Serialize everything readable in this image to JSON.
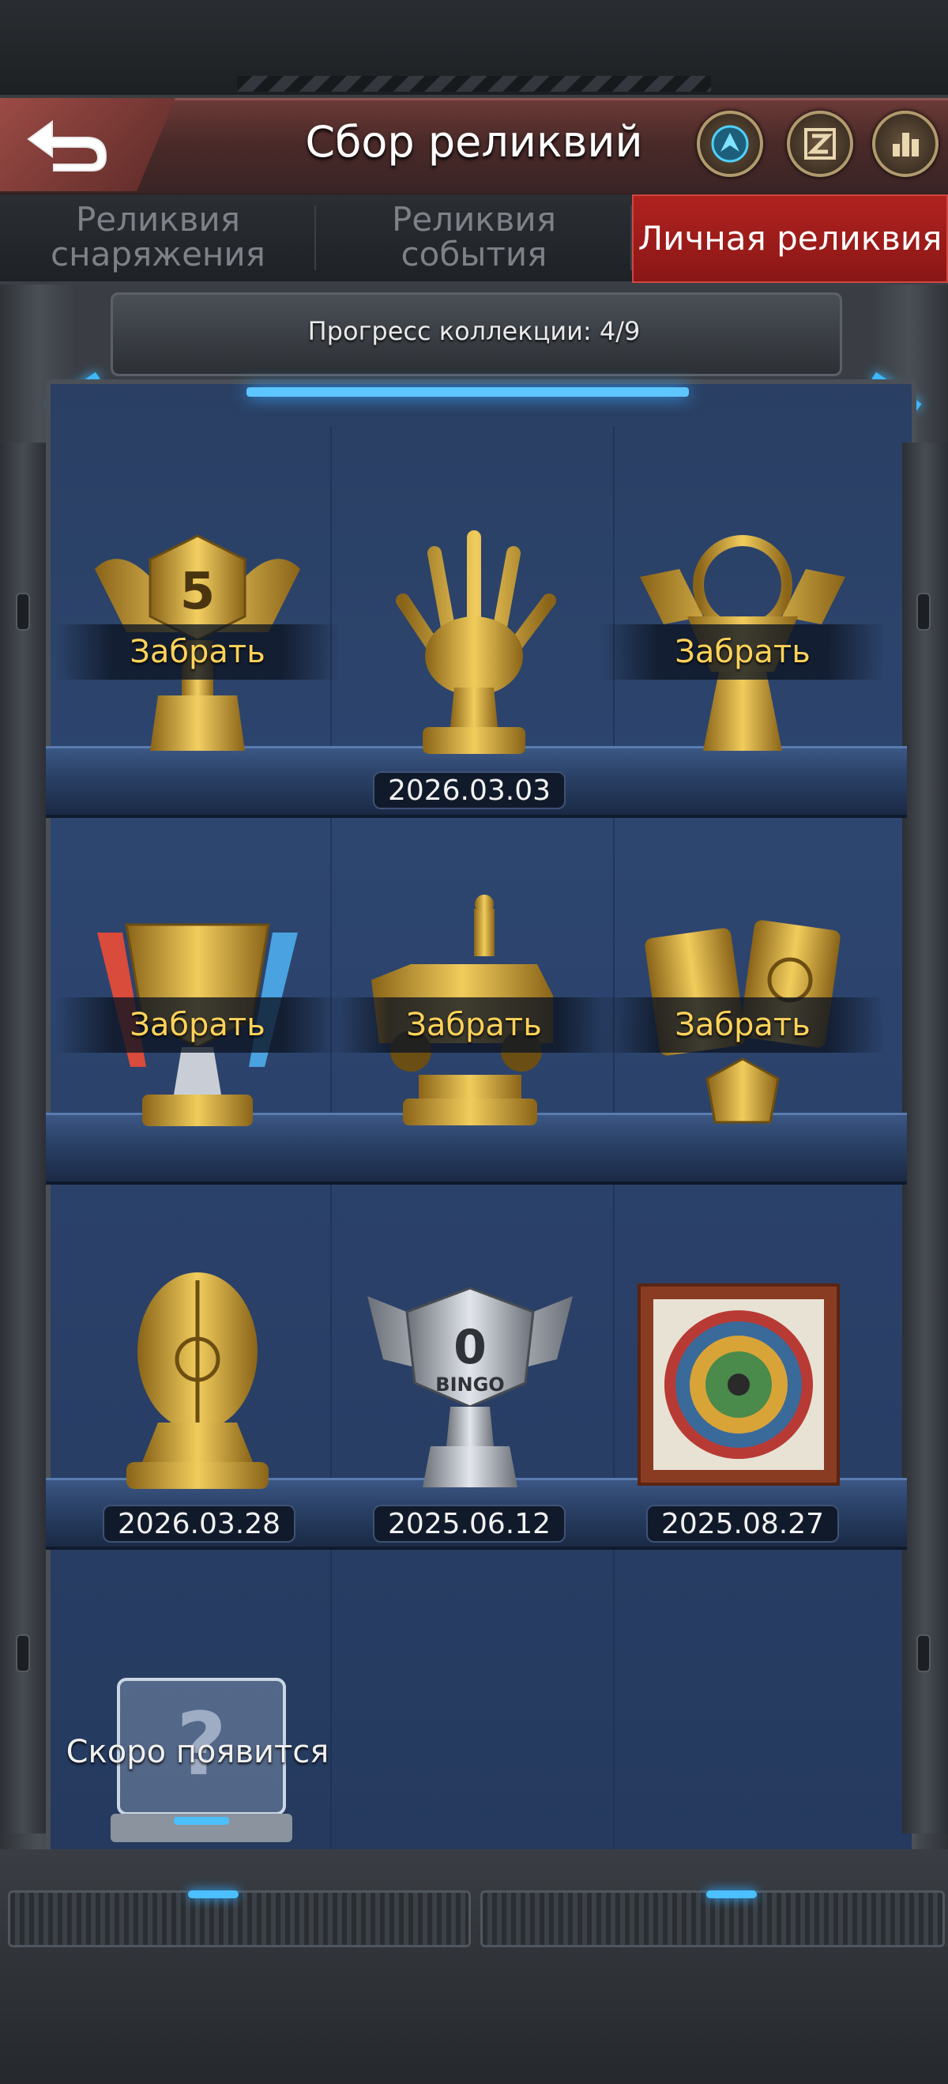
{
  "header": {
    "title": "Сбор реликвий",
    "buttons": [
      "back-arrow-icon",
      "compass-icon",
      "z-badge-icon",
      "ranking-icon"
    ]
  },
  "tabs": [
    {
      "label_line1": "Реликвия",
      "label_line2": "снаряжения",
      "active": false
    },
    {
      "label_line1": "Реликвия",
      "label_line2": "события",
      "active": false
    },
    {
      "label_line1": "Личная реликвия",
      "label_line2": "",
      "active": true
    }
  ],
  "collection": {
    "progress_text": "Прогресс коллекции: 4/9"
  },
  "relics": [
    {
      "icon": "bingo-5-trophy-icon",
      "status": "Забрать",
      "date": ""
    },
    {
      "icon": "golden-hand-trophy-icon",
      "status": "",
      "date": "2026.03.03"
    },
    {
      "icon": "steering-wheel-trophy-icon",
      "status": "Забрать",
      "date": ""
    },
    {
      "icon": "shield-cup-trophy-icon",
      "status": "Забрать",
      "date": ""
    },
    {
      "icon": "vehicle-soldier-trophy-icon",
      "status": "Забрать",
      "date": ""
    },
    {
      "icon": "golden-cards-trophy-icon",
      "status": "Забрать",
      "date": ""
    },
    {
      "icon": "golden-egg-trophy-icon",
      "status": "",
      "date": "2026.03.28"
    },
    {
      "icon": "bingo-0-silver-trophy-icon",
      "status": "",
      "date": "2025.06.12"
    },
    {
      "icon": "framed-wheel-painting-icon",
      "status": "",
      "date": "2025.08.27"
    },
    {
      "icon": "mystery-box-icon",
      "status": "Скоро появится",
      "date": ""
    }
  ],
  "colors": {
    "accent_red": "#b0221f",
    "claim_text": "#ffd25a",
    "glow_blue": "#3cb8ff",
    "shelf_blue": "#2d4670"
  }
}
